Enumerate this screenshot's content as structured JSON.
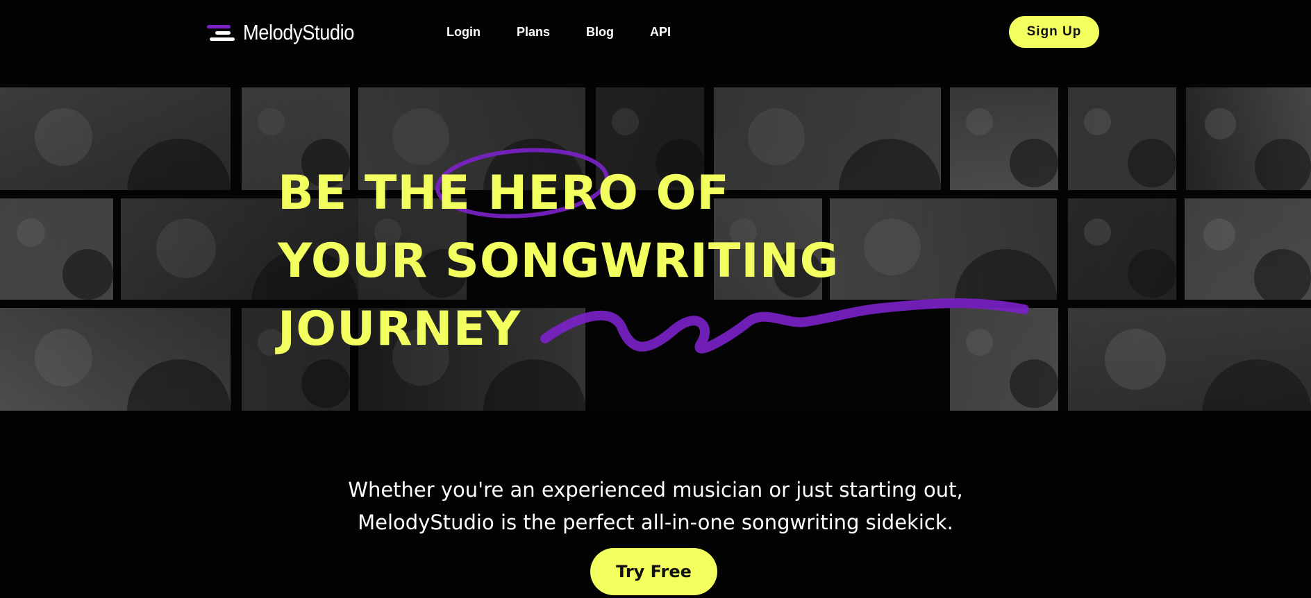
{
  "brand": {
    "name": "MelodyStudio",
    "logo_icon": "menu-lines-icon",
    "accent": "#f2ff5e",
    "purple": "#7b22c9"
  },
  "nav": {
    "links": [
      {
        "label": "Login"
      },
      {
        "label": "Plans"
      },
      {
        "label": "Blog"
      },
      {
        "label": "API"
      }
    ],
    "signup_label": "Sign Up"
  },
  "hero": {
    "headline_lines": [
      {
        "before": "BE THE ",
        "highlight": "HERO",
        "after": " OF"
      },
      {
        "text": "YOUR SONGWRITING"
      },
      {
        "text": "JOURNEY"
      }
    ],
    "photos": [
      "piano-keys-photo",
      "smiling-singer-headphones-photo",
      "street-musician-photo",
      "studio-microphone-photo",
      "singer-afro-photo",
      "vocalist-microphone-photo",
      "midi-keyboard-photo",
      "mixing-console-photo",
      "guitarist-cap-photo",
      "singer-side-profile-photo",
      "studio-monitors-photo",
      "woman-guitar-hat-photo",
      "headphones-producer-photo",
      "guitarist-headphones-photo",
      "microphone-hands-photo",
      "drummer-photo",
      "acoustic-guitar-photo",
      "guitar-coffee-photo",
      "violinist-photo",
      "woman-microphone-photo"
    ]
  },
  "subtitle": {
    "line1": "Whether you're an experienced musician or just starting out,",
    "line2": "MelodyStudio is the perfect all-in-one songwriting sidekick."
  },
  "cta": {
    "label": "Try Free"
  }
}
